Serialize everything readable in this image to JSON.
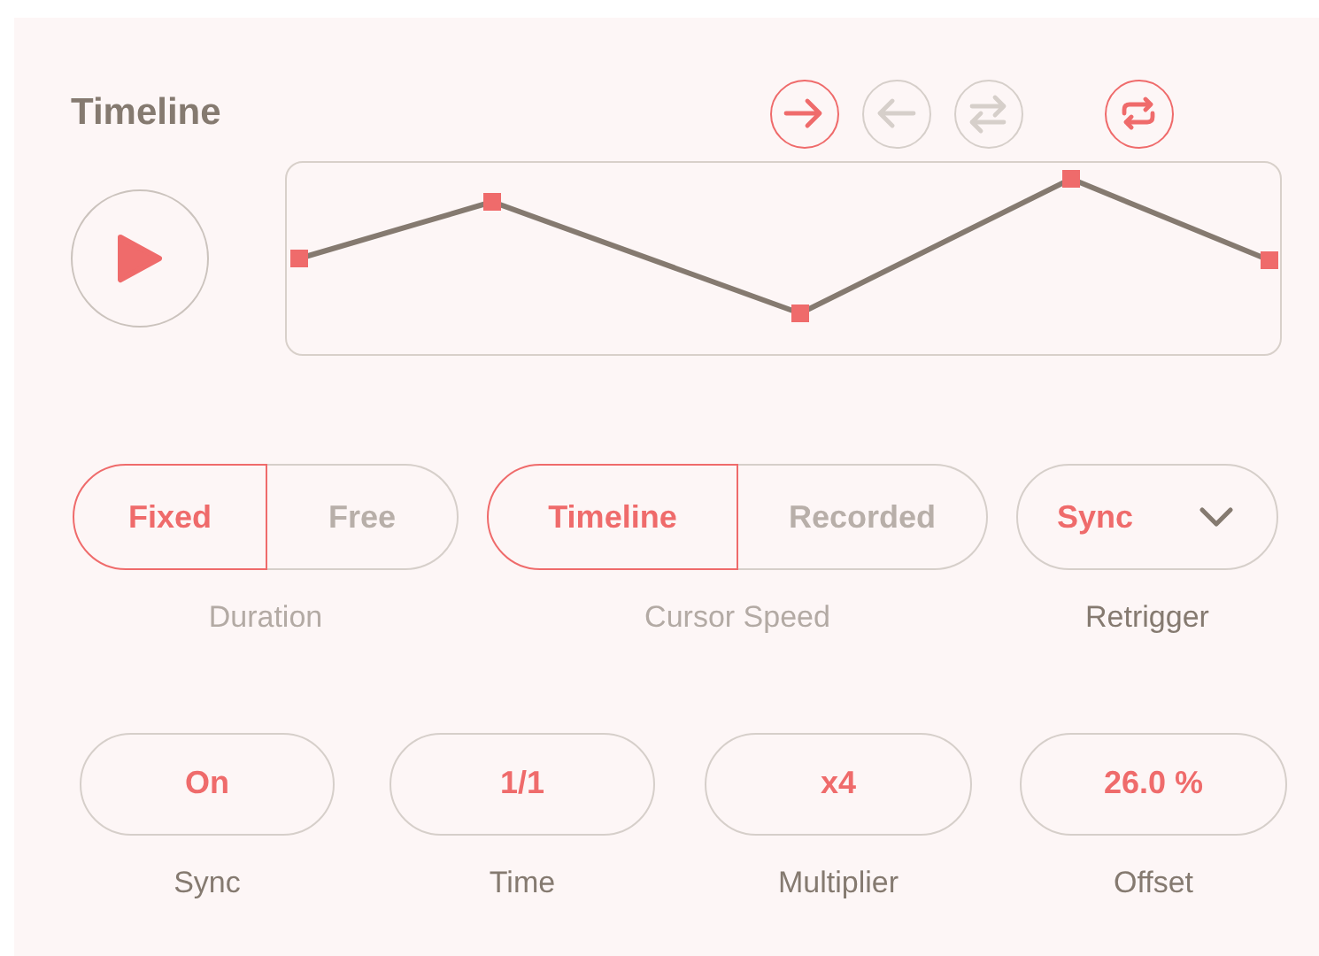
{
  "title": "Timeline",
  "direction_buttons": [
    {
      "kind": "forward",
      "selected": true
    },
    {
      "kind": "backward",
      "selected": false
    },
    {
      "kind": "pingpong",
      "selected": false
    }
  ],
  "loop_button": {
    "on": true
  },
  "segmented_controls": [
    {
      "label": "Duration",
      "dimmed": true,
      "options": [
        {
          "label": "Fixed",
          "selected": true
        },
        {
          "label": "Free",
          "selected": false
        }
      ]
    },
    {
      "label": "Cursor Speed",
      "dimmed": true,
      "options": [
        {
          "label": "Timeline",
          "selected": true
        },
        {
          "label": "Recorded",
          "selected": false
        }
      ]
    }
  ],
  "retrigger": {
    "value": "Sync",
    "label": "Retrigger"
  },
  "parameters": [
    {
      "value": "On",
      "label": "Sync"
    },
    {
      "value": "1/1",
      "label": "Time"
    },
    {
      "value": "x4",
      "label": "Multiplier"
    },
    {
      "value": "26.0 %",
      "label": "Offset"
    }
  ]
}
